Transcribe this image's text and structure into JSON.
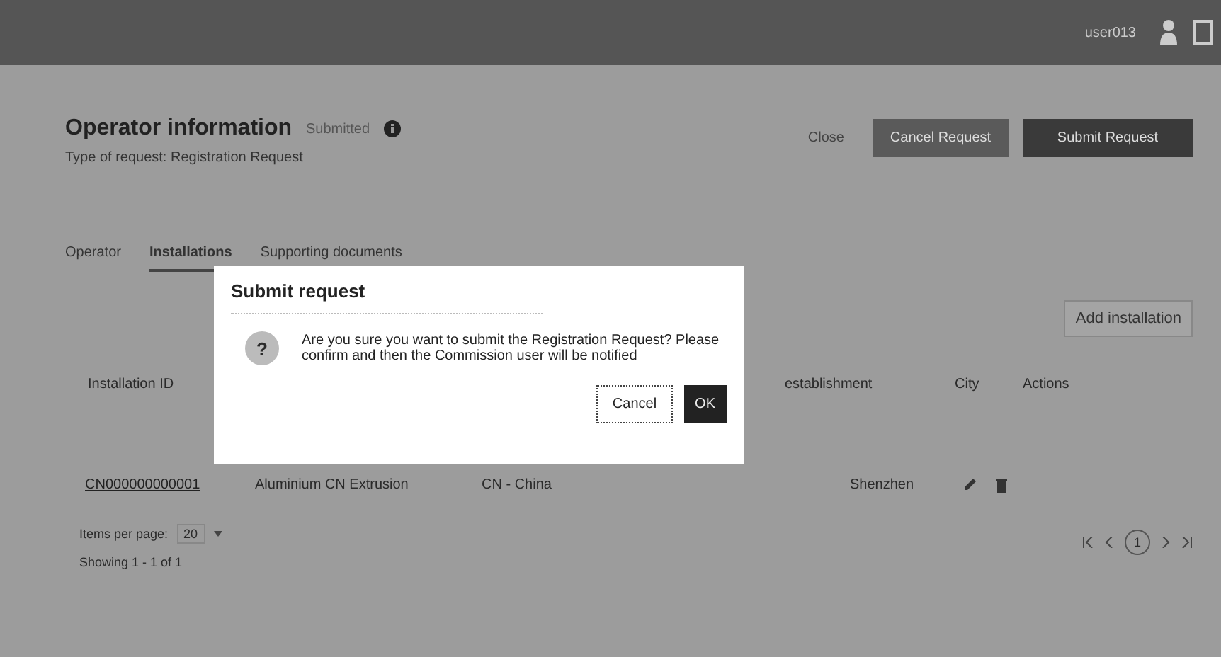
{
  "top_bar": {
    "username": "user013"
  },
  "header": {
    "title": "Operator information",
    "status": "Submitted",
    "subtitle": "Type of request: Registration Request",
    "buttons": [
      {
        "label": "Close",
        "kind": "link"
      },
      {
        "label": "Cancel Request",
        "kind": "secondary"
      },
      {
        "label": "Submit Request",
        "kind": "primary"
      }
    ]
  },
  "tabs": [
    {
      "label": "Operator",
      "selected": false
    },
    {
      "label": "Installations",
      "selected": true
    },
    {
      "label": "Supporting documents",
      "selected": false
    }
  ],
  "add_button": "Add installation",
  "table": {
    "columns": [
      "Installation ID",
      "establishment",
      "City",
      "Actions"
    ],
    "rows": [
      {
        "id": "CN000000000001",
        "name": "Aluminium CN Extrusion",
        "country": "CN - China",
        "city": "Shenzhen"
      }
    ]
  },
  "footer": {
    "items_per_page_label": "Items per page:",
    "items_per_page": "20",
    "showing": "Showing 1 - 1 of 1",
    "current_page": "1"
  },
  "dialog": {
    "title": "Submit request",
    "message": "Are you sure you want to submit the Registration Request? Please confirm and then the Commission user will be notified",
    "icon_text": "?",
    "buttons": [
      {
        "label": "Cancel",
        "kind": "secondary"
      },
      {
        "label": "OK",
        "kind": "primary"
      }
    ]
  }
}
